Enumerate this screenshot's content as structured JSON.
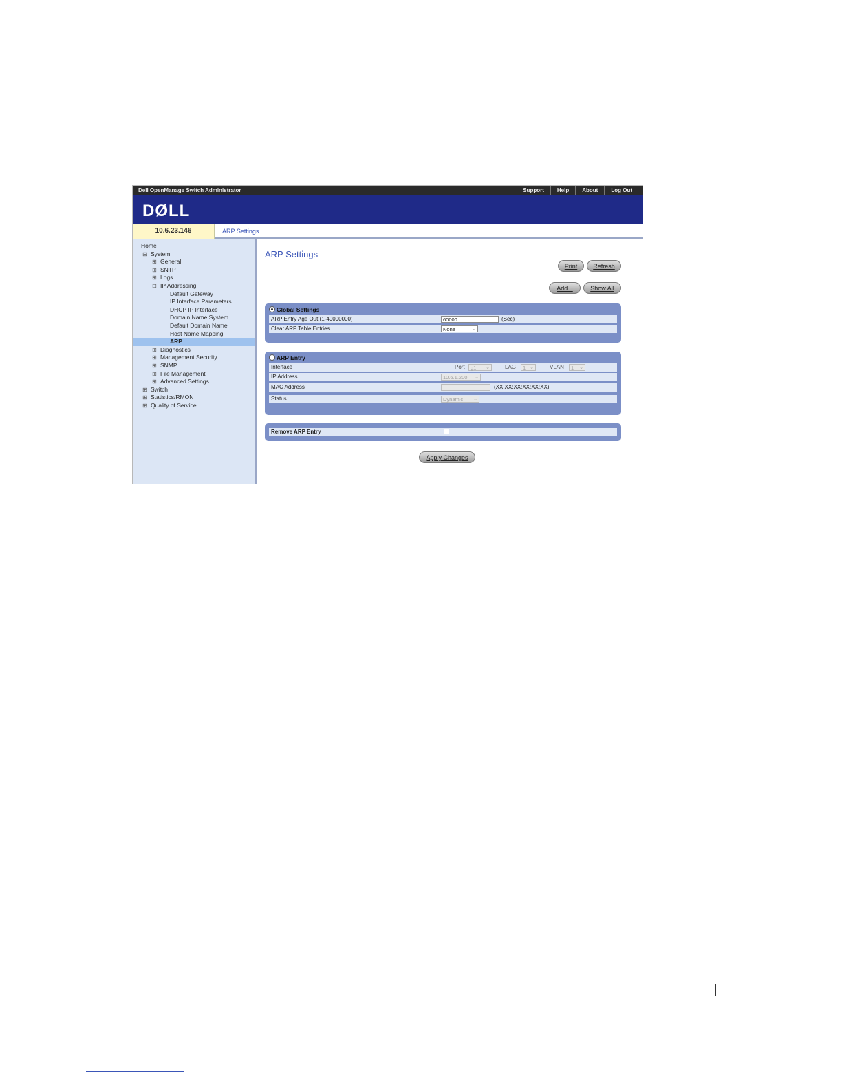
{
  "topbar": {
    "app_title": "Dell OpenManage Switch Administrator",
    "links": [
      "Support",
      "Help",
      "About",
      "Log Out"
    ]
  },
  "brand": {
    "logo": "DØLL"
  },
  "tabrow": {
    "ip": "10.6.23.146",
    "breadcrumb": "ARP Settings"
  },
  "nav": {
    "items": [
      {
        "label": "Home",
        "level": 0,
        "exp": ""
      },
      {
        "label": "System",
        "level": 1,
        "exp": "⊟"
      },
      {
        "label": "General",
        "level": 2,
        "exp": "⊞"
      },
      {
        "label": "SNTP",
        "level": 2,
        "exp": "⊞"
      },
      {
        "label": "Logs",
        "level": 2,
        "exp": "⊞"
      },
      {
        "label": "IP Addressing",
        "level": 2,
        "exp": "⊟"
      },
      {
        "label": "Default Gateway",
        "level": 3,
        "exp": ""
      },
      {
        "label": "IP Interface Parameters",
        "level": 3,
        "exp": ""
      },
      {
        "label": "DHCP IP Interface",
        "level": 3,
        "exp": ""
      },
      {
        "label": "Domain Name System",
        "level": 3,
        "exp": ""
      },
      {
        "label": "Default Domain Name",
        "level": 3,
        "exp": ""
      },
      {
        "label": "Host Name Mapping",
        "level": 3,
        "exp": ""
      },
      {
        "label": "ARP",
        "level": 3,
        "exp": "",
        "selected": true
      },
      {
        "label": "Diagnostics",
        "level": 2,
        "exp": "⊞"
      },
      {
        "label": "Management Security",
        "level": 2,
        "exp": "⊞"
      },
      {
        "label": "SNMP",
        "level": 2,
        "exp": "⊞"
      },
      {
        "label": "File Management",
        "level": 2,
        "exp": "⊞"
      },
      {
        "label": "Advanced Settings",
        "level": 2,
        "exp": "⊞"
      },
      {
        "label": "Switch",
        "level": 1,
        "exp": "⊞"
      },
      {
        "label": "Statistics/RMON",
        "level": 1,
        "exp": "⊞"
      },
      {
        "label": "Quality of Service",
        "level": 1,
        "exp": "⊞"
      }
    ]
  },
  "main": {
    "title": "ARP Settings",
    "print_label": "Print",
    "refresh_label": "Refresh",
    "add_label": "Add...",
    "show_all_label": "Show All",
    "global": {
      "header": "Global Settings",
      "age_label": "ARP Entry Age Out  (1-40000000)",
      "age_value": "60000",
      "age_unit": "(Sec)",
      "clear_label": "Clear ARP Table Entries",
      "clear_value": "None"
    },
    "entry": {
      "header": "ARP Entry",
      "interface_label": "Interface",
      "port_label": "Port",
      "port_value": "g1",
      "lag_label": "LAG",
      "lag_value": "1",
      "vlan_label": "VLAN",
      "vlan_value": "1",
      "ip_label": "IP Address",
      "ip_value": "10.6.1.200",
      "mac_label": "MAC Address",
      "mac_format": "(XX:XX:XX:XX:XX:XX)",
      "status_label": "Status",
      "status_value": "Dynamic"
    },
    "remove": {
      "label": "Remove ARP Entry"
    },
    "apply_label": "Apply Changes"
  }
}
